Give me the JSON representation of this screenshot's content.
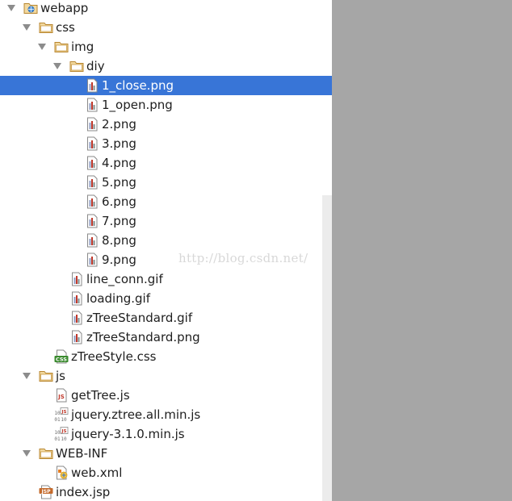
{
  "project_tree": {
    "items": [
      {
        "label": "webapp",
        "icon": "web-module-icon",
        "depth": 0,
        "expanded": true,
        "selected": false
      },
      {
        "label": "css",
        "icon": "folder-icon",
        "depth": 1,
        "expanded": true,
        "selected": false
      },
      {
        "label": "img",
        "icon": "folder-icon",
        "depth": 2,
        "expanded": true,
        "selected": false
      },
      {
        "label": "diy",
        "icon": "folder-icon",
        "depth": 3,
        "expanded": true,
        "selected": false
      },
      {
        "label": "1_close.png",
        "icon": "image-file-icon",
        "depth": 4,
        "selected": true
      },
      {
        "label": "1_open.png",
        "icon": "image-file-icon",
        "depth": 4,
        "selected": false
      },
      {
        "label": "2.png",
        "icon": "image-file-icon",
        "depth": 4,
        "selected": false
      },
      {
        "label": "3.png",
        "icon": "image-file-icon",
        "depth": 4,
        "selected": false
      },
      {
        "label": "4.png",
        "icon": "image-file-icon",
        "depth": 4,
        "selected": false
      },
      {
        "label": "5.png",
        "icon": "image-file-icon",
        "depth": 4,
        "selected": false
      },
      {
        "label": "6.png",
        "icon": "image-file-icon",
        "depth": 4,
        "selected": false
      },
      {
        "label": "7.png",
        "icon": "image-file-icon",
        "depth": 4,
        "selected": false
      },
      {
        "label": "8.png",
        "icon": "image-file-icon",
        "depth": 4,
        "selected": false
      },
      {
        "label": "9.png",
        "icon": "image-file-icon",
        "depth": 4,
        "selected": false
      },
      {
        "label": "line_conn.gif",
        "icon": "image-file-icon",
        "depth": 3,
        "selected": false
      },
      {
        "label": "loading.gif",
        "icon": "image-file-icon",
        "depth": 3,
        "selected": false
      },
      {
        "label": "zTreeStandard.gif",
        "icon": "image-file-icon",
        "depth": 3,
        "selected": false
      },
      {
        "label": "zTreeStandard.png",
        "icon": "image-file-icon",
        "depth": 3,
        "selected": false
      },
      {
        "label": "zTreeStyle.css",
        "icon": "css-file-icon",
        "depth": 2,
        "selected": false
      },
      {
        "label": "js",
        "icon": "folder-icon",
        "depth": 1,
        "expanded": true,
        "selected": false
      },
      {
        "label": "getTree.js",
        "icon": "js-file-icon",
        "depth": 2,
        "selected": false
      },
      {
        "label": "jquery.ztree.all.min.js",
        "icon": "js-binary-file-icon",
        "depth": 2,
        "selected": false
      },
      {
        "label": "jquery-3.1.0.min.js",
        "icon": "js-binary-file-icon",
        "depth": 2,
        "selected": false
      },
      {
        "label": "WEB-INF",
        "icon": "folder-icon",
        "depth": 1,
        "expanded": true,
        "selected": false
      },
      {
        "label": "web.xml",
        "icon": "xml-file-icon",
        "depth": 2,
        "selected": false
      },
      {
        "label": "index.jsp",
        "icon": "jsp-file-icon",
        "depth": 1,
        "selected": false
      }
    ]
  },
  "watermark": "http://blog.csdn.net/",
  "colors": {
    "selection": "#3875d7",
    "folder": "#d9a441",
    "gray_area": "#a6a6a6"
  }
}
